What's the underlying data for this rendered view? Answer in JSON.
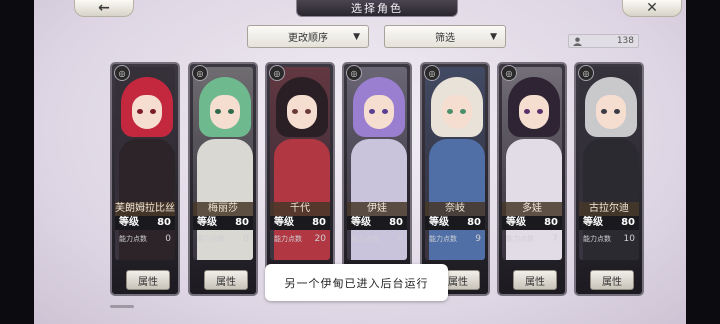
{
  "header": {
    "title": "选择角色",
    "back_icon": "←",
    "close_icon": "✕"
  },
  "filters": {
    "sort_label": "更改顺序",
    "filter_label": "筛选",
    "caret": "▼"
  },
  "owned": {
    "count": "138"
  },
  "labels": {
    "level": "等级",
    "points": "能力点数",
    "attr_button": "属性"
  },
  "cards": [
    {
      "name": "芙朗姆拉比丝",
      "level": "80",
      "points": "0",
      "hair": "#c4283f",
      "eye": "#7a1b2a",
      "body": "#2c2428"
    },
    {
      "name": "梅丽莎",
      "level": "80",
      "points": "0",
      "hair": "#6fb98f",
      "eye": "#2f6a4b",
      "body": "#d9d8d2"
    },
    {
      "name": "千代",
      "level": "80",
      "points": "20",
      "hair": "#2a1f24",
      "eye": "#6a3a3a",
      "body": "#b13842"
    },
    {
      "name": "伊娃",
      "level": "80",
      "points": "0",
      "hair": "#9a7fd0",
      "eye": "#5a3f90",
      "body": "#c9c3dc"
    },
    {
      "name": "奈岐",
      "level": "80",
      "points": "9",
      "hair": "#e8e2d8",
      "eye": "#4a8f6a",
      "body": "#4f6fa6"
    },
    {
      "name": "多娃",
      "level": "80",
      "points": "7",
      "hair": "#2e2433",
      "eye": "#5a2f6a",
      "body": "#e2dce6"
    },
    {
      "name": "古拉尔迪",
      "level": "80",
      "points": "10",
      "hair": "#c9c9cc",
      "eye": "#3b3b46",
      "body": "#2a2a30"
    }
  ],
  "toast": {
    "text": "另一个伊甸已进入后台运行"
  }
}
